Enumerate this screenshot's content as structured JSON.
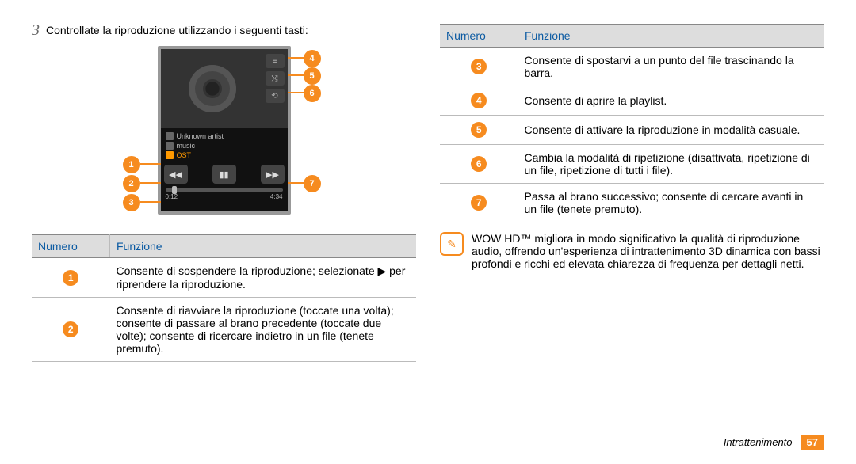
{
  "step_number": "3",
  "step_text": "Controllate la riproduzione utilizzando i seguenti tasti:",
  "player": {
    "artist": "Unknown artist",
    "album": "music",
    "track": "OST",
    "time_elapsed": "0:12",
    "time_total": "4:34",
    "side_icons": [
      "list-icon",
      "shuffle-icon",
      "repeat-icon"
    ],
    "control_icons": [
      "rewind-icon",
      "pause-icon",
      "forward-icon"
    ]
  },
  "table_left": {
    "head_num": "Numero",
    "head_fn": "Funzione",
    "rows": [
      {
        "n": "1",
        "text": "Consente di sospendere la riproduzione; selezionate ▶ per riprendere la riproduzione."
      },
      {
        "n": "2",
        "text": "Consente di riavviare la riproduzione (toccate una volta); consente di passare al brano precedente (toccate due volte); consente di ricercare indietro in un file (tenete premuto)."
      }
    ]
  },
  "table_right": {
    "head_num": "Numero",
    "head_fn": "Funzione",
    "rows": [
      {
        "n": "3",
        "text": "Consente di spostarvi a un punto del file trascinando la barra."
      },
      {
        "n": "4",
        "text": "Consente di aprire la playlist."
      },
      {
        "n": "5",
        "text": "Consente di attivare la riproduzione in modalità casuale."
      },
      {
        "n": "6",
        "text": "Cambia la modalità di ripetizione (disattivata, ripetizione di un file, ripetizione di tutti i file)."
      },
      {
        "n": "7",
        "text": "Passa al brano successivo; consente di cercare avanti in un file (tenete premuto)."
      }
    ]
  },
  "note_text": "WOW HD™ migliora in modo significativo la qualità di riproduzione audio, offrendo un'esperienza di intrattenimento 3D dinamica con bassi profondi e ricchi ed elevata chiarezza di frequenza per dettagli netti.",
  "note_icon_glyph": "✎",
  "footer_section": "Intrattenimento",
  "footer_page": "57"
}
